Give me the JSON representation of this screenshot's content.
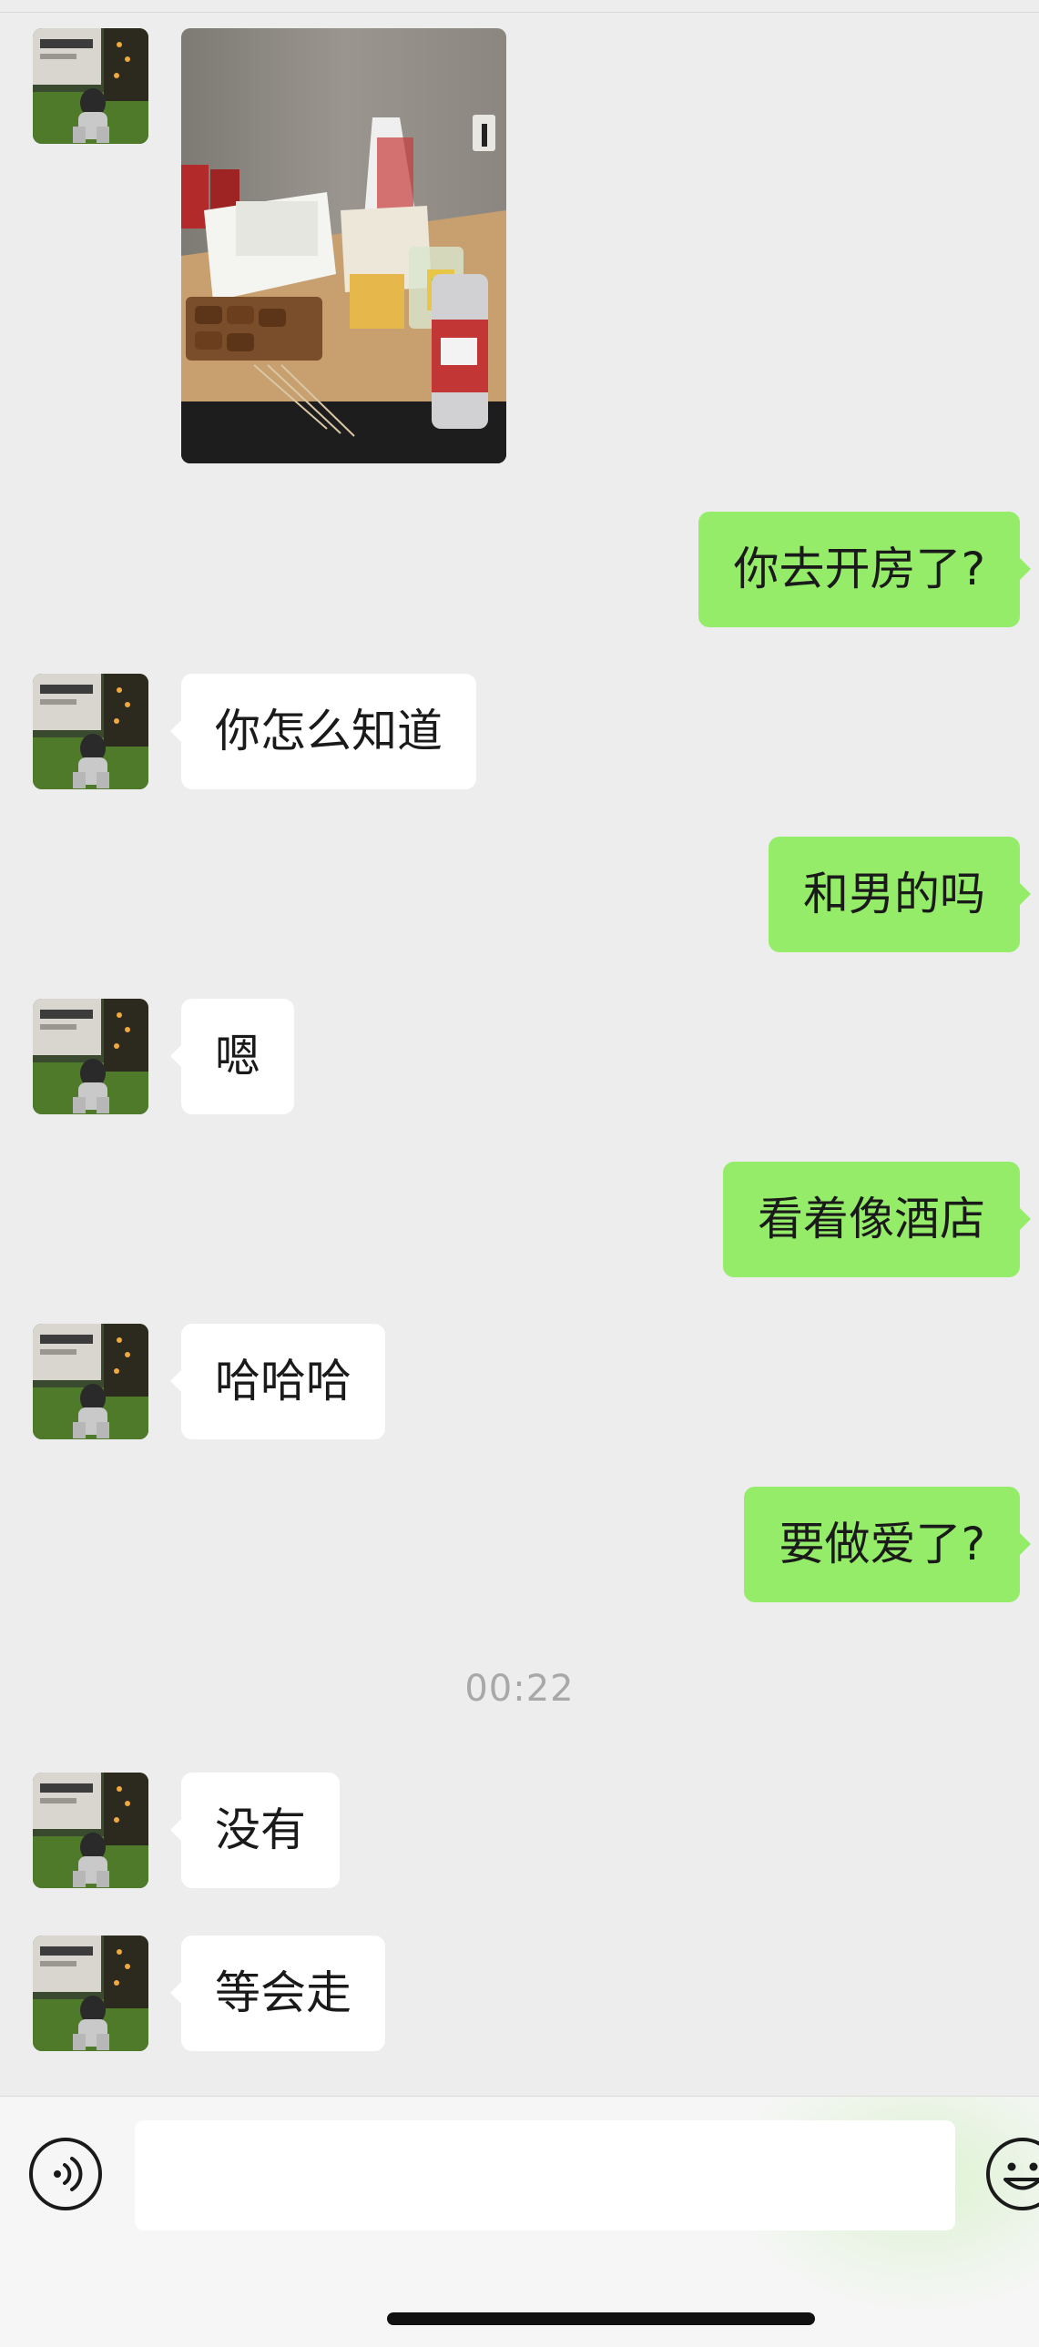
{
  "conversation": {
    "messages": [
      {
        "id": 1,
        "sender": "contact",
        "kind": "image",
        "alt": ""
      },
      {
        "id": 2,
        "sender": "self",
        "kind": "text",
        "text": "你去开房了?"
      },
      {
        "id": 3,
        "sender": "contact",
        "kind": "text",
        "text": "你怎么知道"
      },
      {
        "id": 4,
        "sender": "self",
        "kind": "text",
        "text": "和男的吗"
      },
      {
        "id": 5,
        "sender": "contact",
        "kind": "text",
        "text": "嗯"
      },
      {
        "id": 6,
        "sender": "self",
        "kind": "text",
        "text": "看着像酒店"
      },
      {
        "id": 7,
        "sender": "contact",
        "kind": "text",
        "text": "哈哈哈"
      },
      {
        "id": 8,
        "sender": "self",
        "kind": "text",
        "text": "要做爱了?"
      },
      {
        "id": 9,
        "sender": "contact",
        "kind": "text",
        "text": "没有"
      },
      {
        "id": 10,
        "sender": "contact",
        "kind": "text",
        "text": "等会走"
      }
    ],
    "timestamp": "00:22"
  },
  "input_bar": {
    "value": "",
    "placeholder": "",
    "left_icon": "voice-icon",
    "right_icon": "emoji-icon"
  },
  "colors": {
    "background": "#ededed",
    "self_bubble": "#95ec69",
    "contact_bubble": "#ffffff",
    "timestamp": "#a8a8a8"
  }
}
